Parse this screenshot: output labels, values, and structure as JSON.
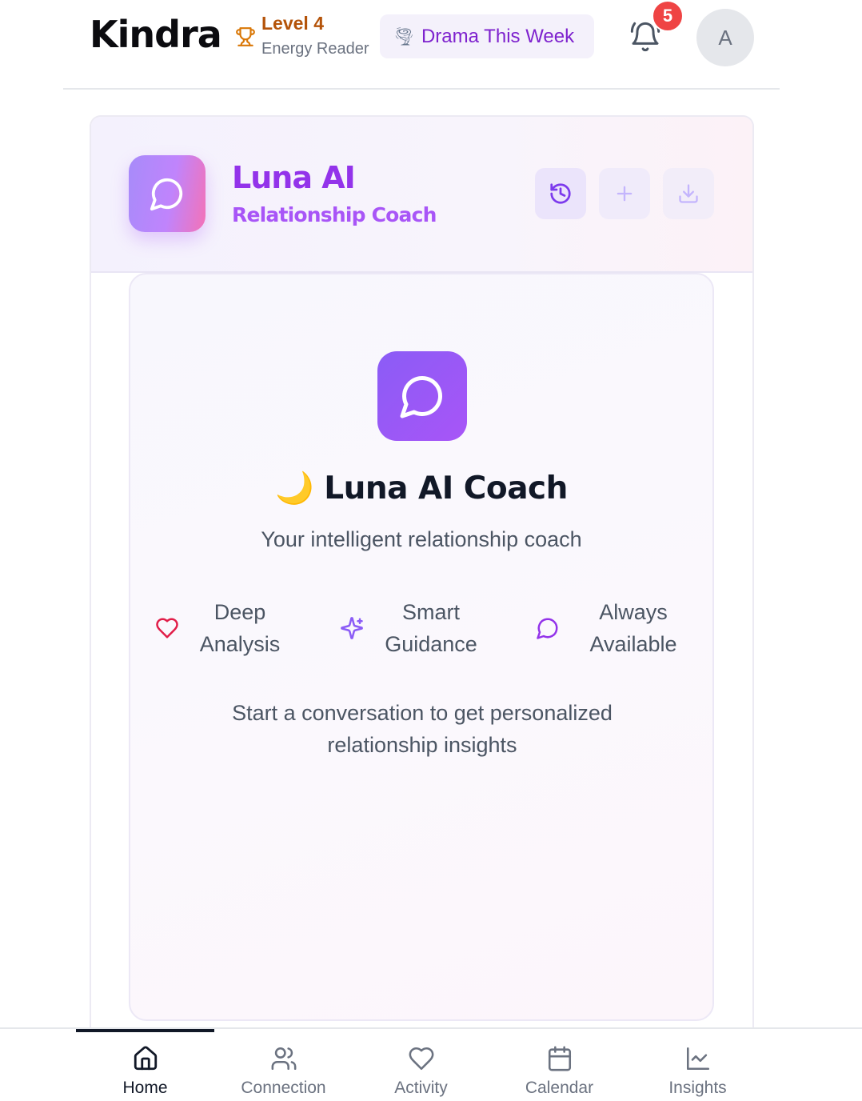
{
  "header": {
    "brand": "Kindra",
    "level_title": "Level 4",
    "level_subtitle": "Energy Reader",
    "drama_emoji": "🌪",
    "drama_label": "Drama This Week",
    "notification_count": "5",
    "avatar_initial": "A"
  },
  "coach_header": {
    "title": "Luna AI",
    "subtitle": "Relationship Coach",
    "icon": "chat-bubble-icon",
    "actions": [
      "history-icon",
      "plus-icon",
      "download-icon"
    ]
  },
  "welcome": {
    "title": "🌙 Luna AI Coach",
    "subtitle": "Your intelligent relationship coach",
    "features": [
      {
        "icon": "heart-icon",
        "label": "Deep Analysis"
      },
      {
        "icon": "sparkles-icon",
        "label": "Smart Guidance"
      },
      {
        "icon": "chat-bubble-icon",
        "label": "Always Available"
      }
    ],
    "cta": "Start a conversation to get personalized relationship insights"
  },
  "nav": {
    "active": "Home",
    "items": [
      {
        "label": "Home",
        "icon": "home-icon"
      },
      {
        "label": "Connection",
        "icon": "users-icon"
      },
      {
        "label": "Activity",
        "icon": "heart-icon"
      },
      {
        "label": "Calendar",
        "icon": "calendar-icon"
      },
      {
        "label": "Insights",
        "icon": "chart-line-icon"
      }
    ]
  },
  "colors": {
    "accent_purple": "#9333ea",
    "level_orange": "#b45309",
    "badge_red": "#ef4444",
    "feature_heart": "#e11d48"
  }
}
